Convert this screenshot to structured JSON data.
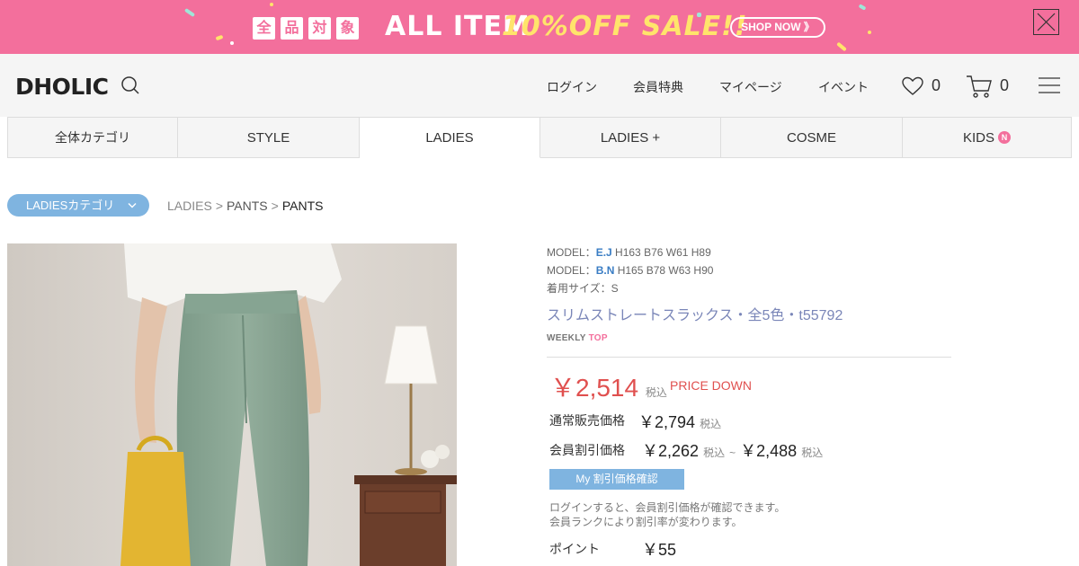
{
  "banner": {
    "kanji": [
      "全",
      "品",
      "対",
      "象"
    ],
    "all_item": "ALL ITEM",
    "sale": "10%OFF SALE!!",
    "shop_now": "SHOP NOW 》",
    "bg_color": "#f36f9c"
  },
  "header": {
    "logo": "DHOLIC",
    "nav": [
      "ログイン",
      "会員特典",
      "マイページ",
      "イベント"
    ],
    "wishlist_count": "0",
    "cart_count": "0"
  },
  "tabs": [
    {
      "label": "全体カテゴリ"
    },
    {
      "label": "STYLE"
    },
    {
      "label": "LADIES"
    },
    {
      "label": "LADIES +"
    },
    {
      "label": "COSME"
    },
    {
      "label": "KIDS"
    }
  ],
  "kids_badge": "N",
  "breadcrumb": {
    "category_button": "LADIESカテゴリ",
    "items": [
      "LADIES",
      "PANTS",
      "PANTS"
    ],
    "separator": ">"
  },
  "product": {
    "models": [
      {
        "prefix": "MODEL：",
        "name": "E.J",
        "size": "H163 B76 W61 H89"
      },
      {
        "prefix": "MODEL：",
        "name": "B.N",
        "size": "H165 B78 W63 H90"
      }
    ],
    "worn_size": "着用サイズ：S",
    "name": "スリムストレートスラックス・全5色・t55792",
    "weekly": "WEEKLY",
    "weekly_top": "TOP",
    "price": "￥2,514",
    "tax_label": "税込",
    "price_down": "PRICE DOWN",
    "regular_label": "通常販売価格",
    "regular_price": "￥2,794",
    "member_label": "会員割引価格",
    "member_price_min": "￥2,262",
    "member_tilde": "~",
    "member_price_max": "￥2,488",
    "my_price_button": "My 割引価格確認",
    "note1": "ログインすると、会員割引価格が確認できます。",
    "note2": "会員ランクにより割引率が変わります。",
    "point_label": "ポイント",
    "point_value": "￥55"
  }
}
